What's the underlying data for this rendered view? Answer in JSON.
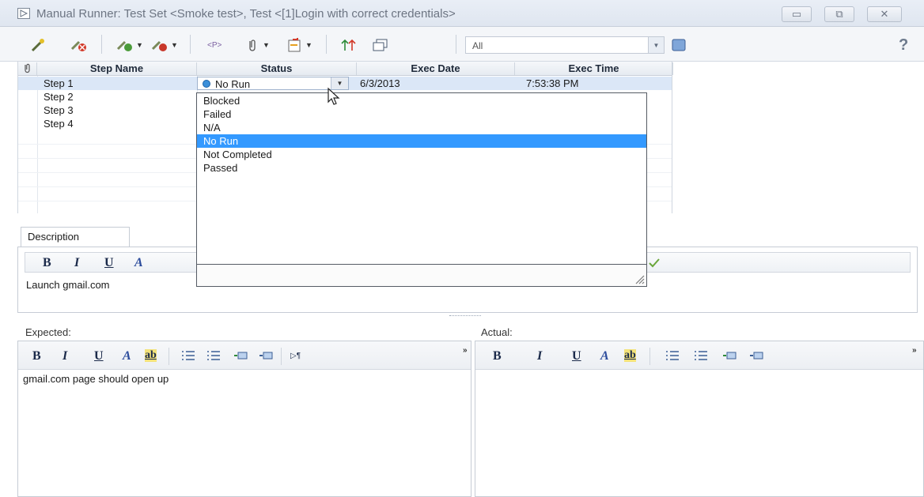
{
  "window": {
    "title": "Manual Runner: Test Set <Smoke test>, Test <[1]Login with correct credentials>",
    "minimize": "▭",
    "maximize": "⧉",
    "close": "✕"
  },
  "toolbar": {
    "filter_value": "All",
    "markup_label": "<P>",
    "help_label": "?"
  },
  "grid": {
    "columns": [
      "Step Name",
      "Status",
      "Exec Date",
      "Exec Time"
    ],
    "rows": [
      {
        "name": "Step 1",
        "status": "No Run",
        "date": "6/3/2013",
        "time": "7:53:38 PM"
      },
      {
        "name": "Step 2"
      },
      {
        "name": "Step 3"
      },
      {
        "name": "Step 4"
      }
    ]
  },
  "status_dropdown": {
    "options": [
      "Blocked",
      "Failed",
      "N/A",
      "No Run",
      "Not Completed",
      "Passed"
    ],
    "highlighted": "No Run"
  },
  "description": {
    "tab_label": "Description",
    "text": "Launch gmail.com",
    "format_buttons": [
      "B",
      "I",
      "U",
      "A"
    ]
  },
  "expected": {
    "label": "Expected:",
    "text": "gmail.com page should open up"
  },
  "actual": {
    "label": "Actual:",
    "text": ""
  },
  "format_toolbar": {
    "bold": "B",
    "italic": "I",
    "underline": "U",
    "color": "A",
    "highlight": "ab",
    "paragraph": "▷¶",
    "more": "»"
  },
  "colors": {
    "selection": "#3399ff",
    "row_selected": "#dbe7f7",
    "status_dot": "#3b8fd9"
  }
}
